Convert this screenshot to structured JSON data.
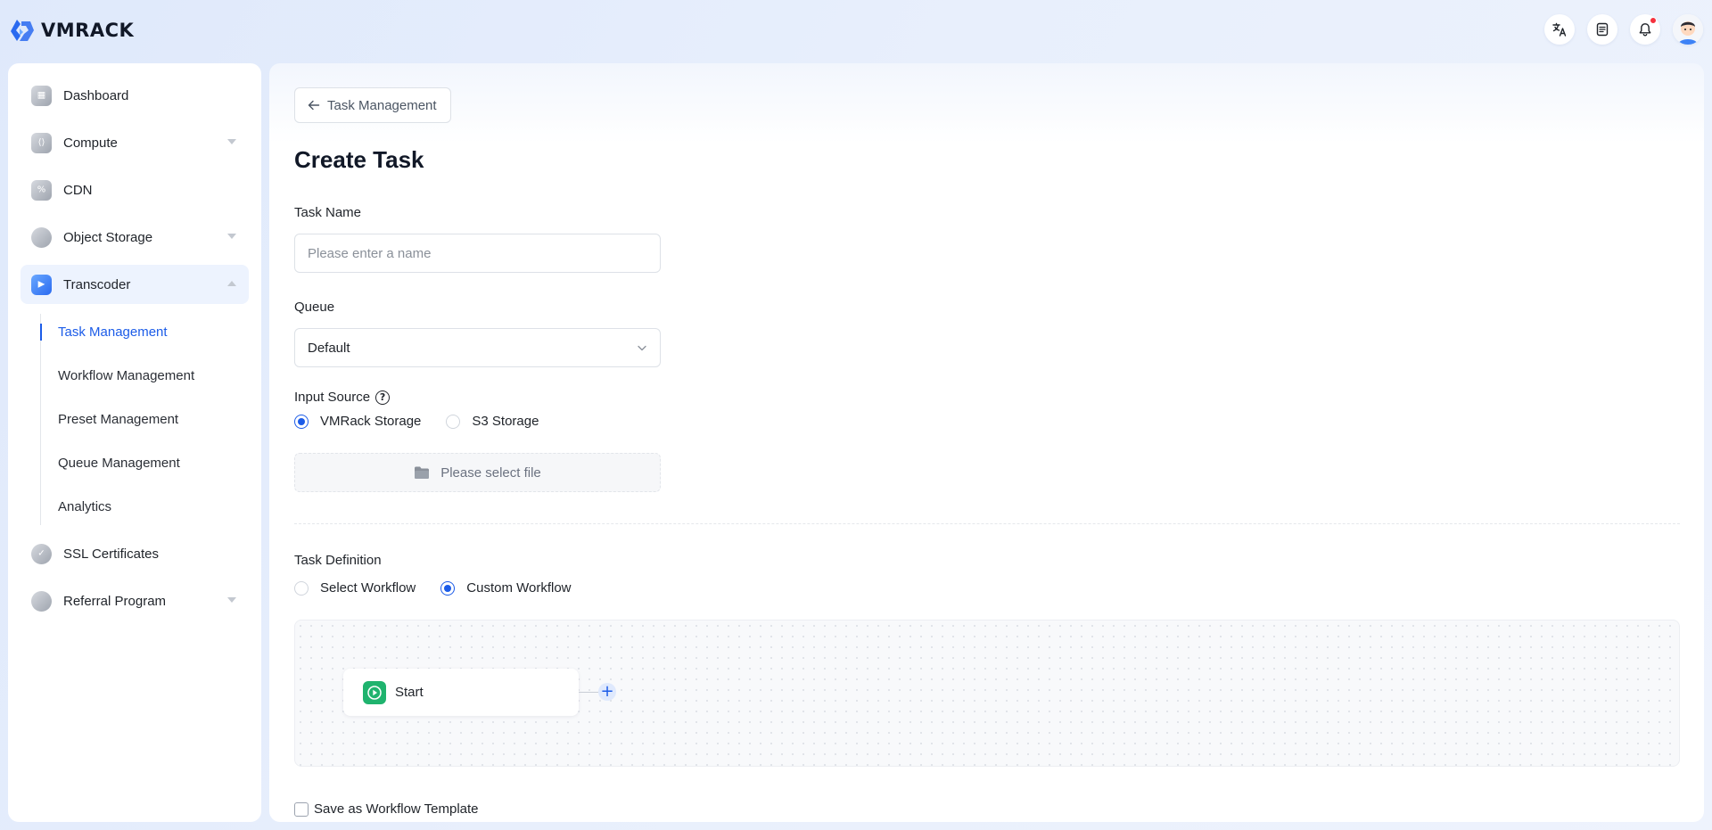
{
  "brand": {
    "name": "VMRACK"
  },
  "topbar": {
    "icons": [
      "translate-icon",
      "document-icon",
      "bell-icon"
    ],
    "notification_dot_color": "#f5313d"
  },
  "sidebar": {
    "items": [
      {
        "label": "Dashboard",
        "icon": "dashboard-icon"
      },
      {
        "label": "Compute",
        "icon": "compute-icon",
        "expandable": true
      },
      {
        "label": "CDN",
        "icon": "cdn-icon"
      },
      {
        "label": "Object Storage",
        "icon": "object-storage-icon",
        "expandable": true
      },
      {
        "label": "Transcoder",
        "icon": "transcoder-icon",
        "expanded": true,
        "active": true
      },
      {
        "label": "SSL Certificates",
        "icon": "ssl-certificate-icon"
      },
      {
        "label": "Referral Program",
        "icon": "referral-icon",
        "expandable": true
      }
    ],
    "transcoder_sub": [
      {
        "label": "Task Management",
        "active": true
      },
      {
        "label": "Workflow Management"
      },
      {
        "label": "Preset Management"
      },
      {
        "label": "Queue Management"
      },
      {
        "label": "Analytics"
      }
    ]
  },
  "main": {
    "back_label": "Task Management",
    "title": "Create Task",
    "task_name": {
      "label": "Task Name",
      "placeholder": "Please enter a name",
      "value": ""
    },
    "queue": {
      "label": "Queue",
      "value": "Default"
    },
    "input_source": {
      "label": "Input Source",
      "options": [
        "VMRack Storage",
        "S3 Storage"
      ],
      "selected": "VMRack Storage",
      "file_button": "Please select file"
    },
    "task_definition": {
      "label": "Task Definition",
      "options": [
        "Select Workflow",
        "Custom Workflow"
      ],
      "selected": "Custom Workflow"
    },
    "workflow": {
      "start_node": "Start",
      "add_symbol": "+"
    },
    "save_template": {
      "label": "Save as Workflow Template",
      "checked": false
    }
  },
  "colors": {
    "accent": "#1c5ce8",
    "start_node": "#1fb36e",
    "active_bg": "#edf3fe"
  }
}
